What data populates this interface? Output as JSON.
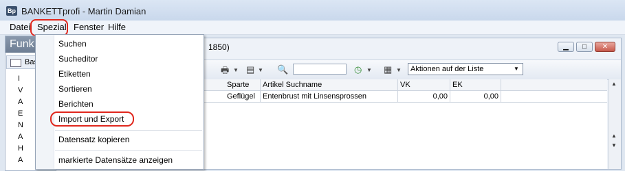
{
  "app": {
    "title": "BANKETTprofi - Martin Damian",
    "icon_text": "Bp"
  },
  "menu": {
    "items": [
      "Datei",
      "Spezial",
      "Fenster",
      "Hilfe"
    ]
  },
  "spezial_menu": {
    "items": [
      "Suchen",
      "Sucheditor",
      "Etiketten",
      "Sortieren",
      "Berichten",
      "Import und Export",
      "Datensatz kopieren",
      "markierte Datensätze anzeigen"
    ]
  },
  "left_panel": {
    "header": "Funk",
    "tab_label": "Bas",
    "icon_letters": [
      "I",
      "V",
      "A",
      "E",
      "N",
      "A",
      "H",
      "A"
    ]
  },
  "child_window": {
    "title_fragment": "1850)",
    "toolbar": {
      "action_combo": "Aktionen auf der Liste"
    },
    "grid": {
      "headers": [
        "Sparte",
        "Artikel Suchname",
        "VK",
        "EK"
      ],
      "rows": [
        {
          "sparte": "Geflügel",
          "suchname": "Entenbrust mit Linsensprossen",
          "vk": "0,00",
          "ek": "0,00"
        }
      ]
    }
  },
  "colors": {
    "highlight": "#e0261c",
    "accent": "#3a4f6c"
  }
}
